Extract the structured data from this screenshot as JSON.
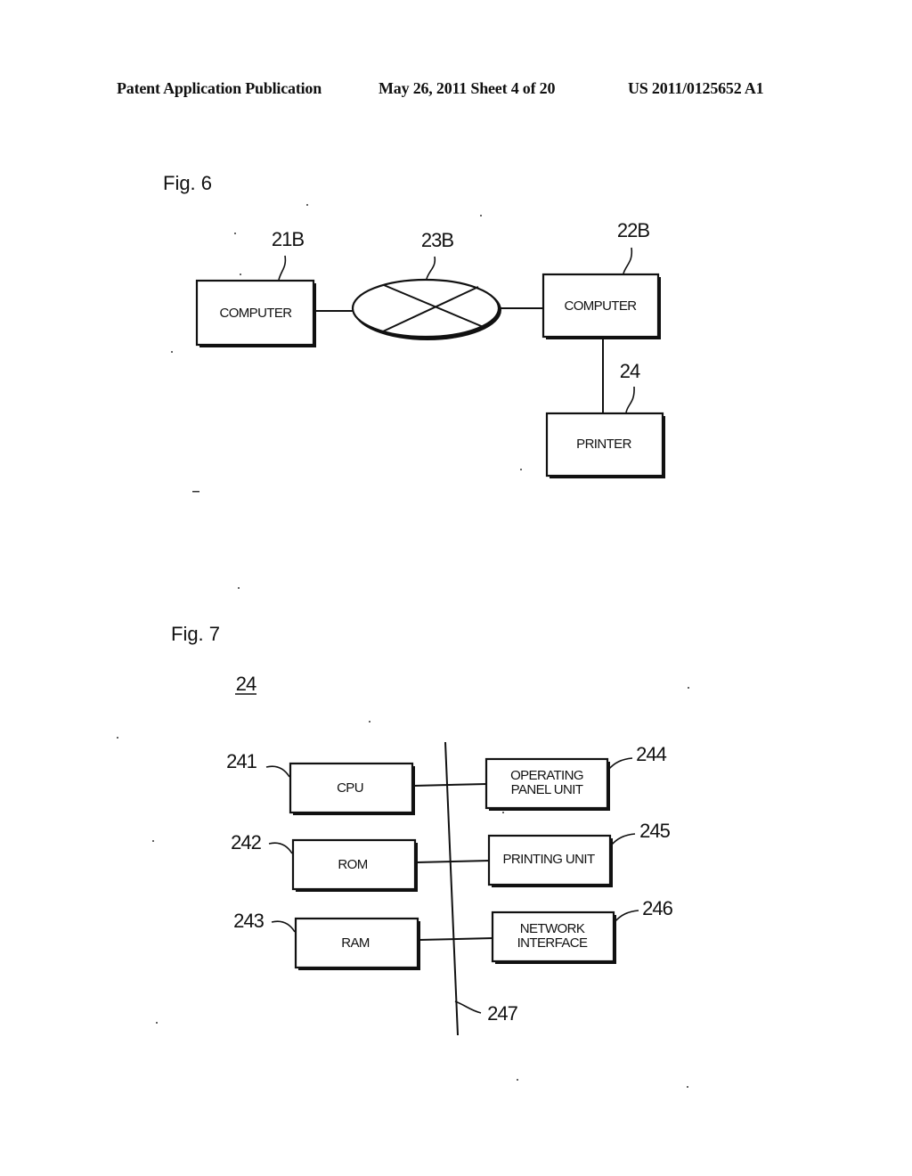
{
  "header": {
    "left": "Patent Application Publication",
    "center": "May 26, 2011  Sheet 4 of 20",
    "right": "US 2011/0125652 A1"
  },
  "fig6": {
    "label": "Fig. 6",
    "nodes": [
      {
        "id": "21B",
        "ref": "21B",
        "text": "COMPUTER",
        "shape": "box"
      },
      {
        "id": "23B",
        "ref": "23B",
        "text": "",
        "shape": "network-ellipse"
      },
      {
        "id": "22B",
        "ref": "22B",
        "text": "COMPUTER",
        "shape": "box"
      },
      {
        "id": "24",
        "ref": "24",
        "text": "PRINTER",
        "shape": "box"
      }
    ],
    "edges": [
      [
        "21B",
        "23B"
      ],
      [
        "23B",
        "22B"
      ],
      [
        "22B",
        "24"
      ]
    ]
  },
  "fig7": {
    "label": "Fig. 7",
    "subject_ref": "24",
    "bus_ref": "247",
    "left_blocks": [
      {
        "ref": "241",
        "lines": [
          "CPU"
        ]
      },
      {
        "ref": "242",
        "lines": [
          "ROM"
        ]
      },
      {
        "ref": "243",
        "lines": [
          "RAM"
        ]
      }
    ],
    "right_blocks": [
      {
        "ref": "244",
        "lines": [
          "OPERATING",
          "PANEL UNIT"
        ]
      },
      {
        "ref": "245",
        "lines": [
          "PRINTING UNIT"
        ]
      },
      {
        "ref": "246",
        "lines": [
          "NETWORK",
          "INTERFACE"
        ]
      }
    ]
  }
}
